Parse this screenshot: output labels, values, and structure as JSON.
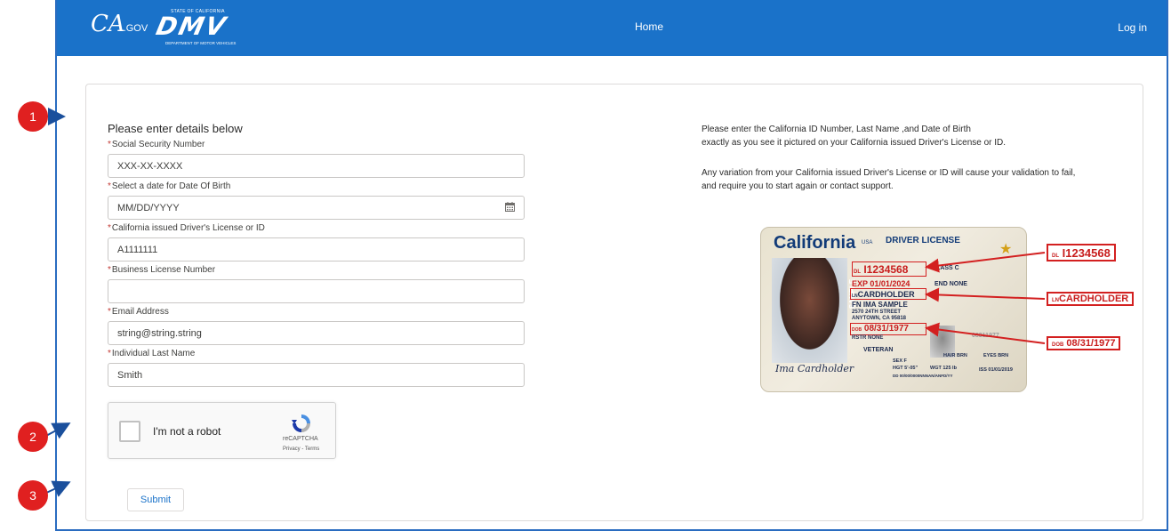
{
  "header": {
    "ca_logo_main": "CA",
    "ca_logo_suffix": ".GOV",
    "dmv_state": "STATE OF CALIFORNIA",
    "dmv_logo": "DMV",
    "dmv_dept": "DEPARTMENT OF MOTOR VEHICLES",
    "home_label": "Home",
    "login_label": "Log in"
  },
  "form": {
    "heading": "Please enter details below",
    "required_mark": "*",
    "fields": [
      {
        "label": "Social Security Number",
        "value": "",
        "placeholder": "XXX-XX-XXXX"
      },
      {
        "label": "Select a date for Date Of Birth",
        "value": "",
        "placeholder": "MM/DD/YYYY"
      },
      {
        "label": "California issued Driver's License or ID",
        "value": "A1111111",
        "placeholder": ""
      },
      {
        "label": "Business License Number",
        "value": "",
        "placeholder": ""
      },
      {
        "label": "Email Address",
        "value": "string@string.string",
        "placeholder": ""
      },
      {
        "label": "Individual Last Name",
        "value": "Smith",
        "placeholder": ""
      }
    ],
    "captcha": {
      "label": "I'm not a robot",
      "brand": "reCAPTCHA",
      "terms": "Privacy - Terms",
      "checked": false
    },
    "submit_label": "Submit"
  },
  "instructions": {
    "line1": "Please enter the California ID Number, Last Name ,and Date of Birth",
    "line2": "exactly as you see it pictured on your California issued Driver's License or ID.",
    "line3": "Any variation from your California issued Driver's License or ID will cause your validation to fail,",
    "line4": "and require you to start again or contact support."
  },
  "license_image": {
    "state": "California",
    "usa": "USA",
    "type": "DRIVER LICENSE",
    "dl_prefix": "DL",
    "dl_number": "I1234568",
    "class_label": "CLASS C",
    "exp": "EXP 01/01/2024",
    "end": "END NONE",
    "ln_prefix": "LN",
    "last_name": "CARDHOLDER",
    "first_name": "FN IMA SAMPLE",
    "address1": "2570 24TH STREET",
    "address2": "ANYTOWN, CA 95818",
    "dob_prefix": "DOB",
    "dob": "08/31/1977",
    "rstr": "RSTR NONE",
    "veteran": "VETERAN",
    "sex": "SEX F",
    "hair": "HAIR BRN",
    "eyes": "EYES BRN",
    "hgt": "HGT 5'-05\"",
    "wgt": "WGT 125 lb",
    "iss": "ISS 01/01/2019",
    "dd": "DD 00/00/0000NNNAN/ANFD/YY",
    "small_dob": "08311977",
    "sample": "SAMPLE",
    "signature": "Ima Cardholder"
  },
  "markers": [
    "1",
    "2",
    "3"
  ],
  "colors": {
    "header_bg": "#1a72c9",
    "required": "#c23934",
    "marker": "#e02020",
    "callout_red": "#d32020"
  }
}
